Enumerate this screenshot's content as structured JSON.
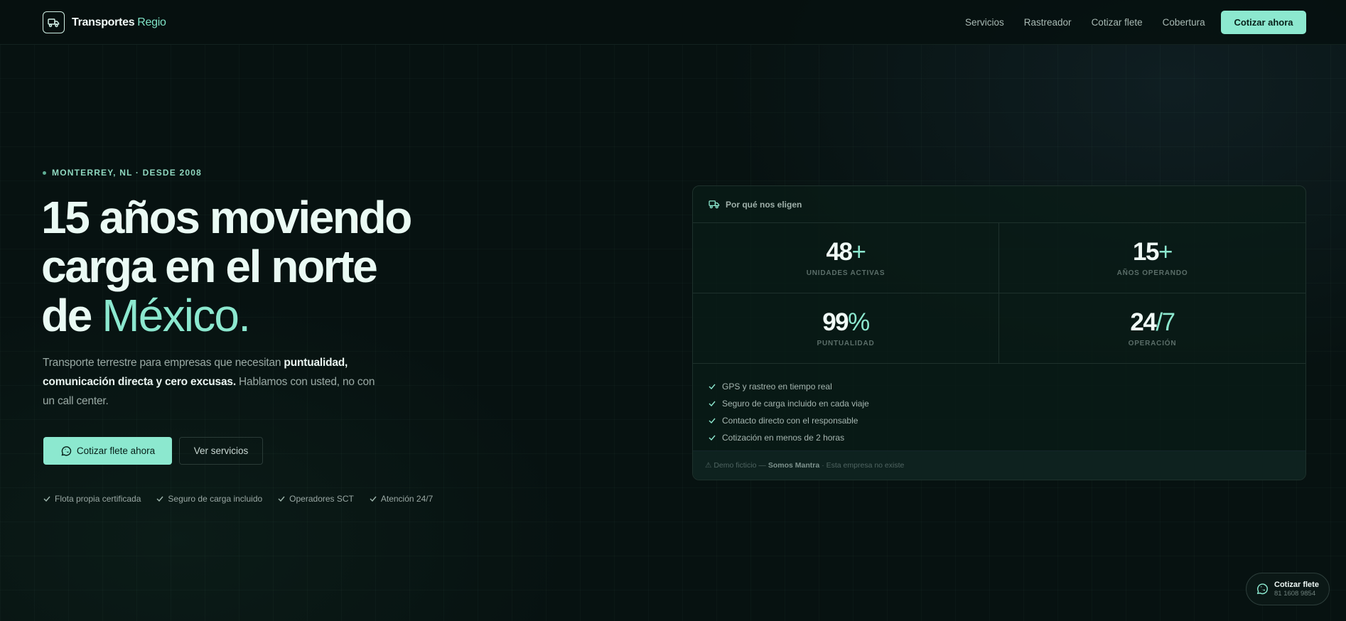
{
  "nav": {
    "brand": {
      "name": "Transportes",
      "accent": "Regio"
    },
    "links": [
      "Servicios",
      "Rastreador",
      "Cotizar flete",
      "Cobertura"
    ],
    "cta": "Cotizar ahora"
  },
  "hero": {
    "eyebrow": "MONTERREY, NL · DESDE 2008",
    "headline": {
      "line1": "15 años moviendo",
      "line2": "carga en el norte",
      "line3_plain": "de ",
      "line3_accent": "México."
    },
    "lede": {
      "part1": "Transporte terrestre para empresas que necesitan ",
      "bold": "puntualidad, comunicación directa y cero excusas.",
      "part2": " Hablamos con usted, no con un call center."
    },
    "primary_button": "Cotizar flete ahora",
    "secondary_button": "Ver servicios",
    "badges": [
      "Flota propia certificada",
      "Seguro de carga incluido",
      "Operadores SCT",
      "Atención 24/7"
    ]
  },
  "card": {
    "title": "Por qué nos eligen",
    "stats": [
      {
        "value": "48",
        "suffix": "+",
        "label": "UNIDADES ACTIVAS"
      },
      {
        "value": "15",
        "suffix": "+",
        "label": "AÑOS OPERANDO"
      },
      {
        "value": "99",
        "suffix": "%",
        "label": "PUNTUALIDAD"
      },
      {
        "value": "24",
        "suffix": "/7",
        "label": "OPERACIÓN"
      }
    ],
    "features": [
      "GPS y rastreo en tiempo real",
      "Seguro de carga incluido en cada viaje",
      "Contacto directo con el responsable",
      "Cotización en menos de 2 horas"
    ],
    "footer": {
      "prefix": "⚠ Demo ficticio —",
      "brand": "Somos Mantra",
      "suffix": "· Esta empresa no existe"
    }
  },
  "floating": {
    "title": "Cotizar flete",
    "phone": "81 1608 9854"
  },
  "colors": {
    "accent": "#8ce8cf",
    "background": "#071211",
    "card": "#0a1c17"
  }
}
